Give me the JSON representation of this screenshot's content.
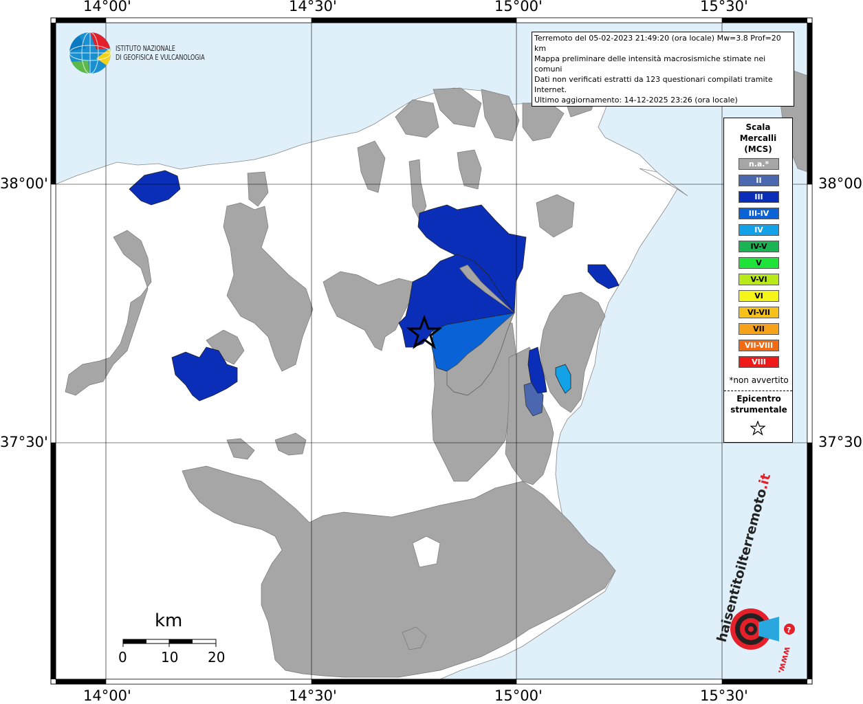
{
  "map": {
    "lon_labels": [
      "14°00'",
      "14°30'",
      "15°00'",
      "15°30'"
    ],
    "lat_labels": [
      "38°00'",
      "37°30'"
    ],
    "land_color": "#ffffff",
    "sea_color": "#e0f0fb",
    "na_color": "#a6a6a6",
    "epicenter_marker": "star"
  },
  "institute": {
    "line1": "ISTITUTO NAZIONALE",
    "line2": "DI GEOFISICA E VULCANOLOGIA",
    "logo_icon": "ingv-globe-logo"
  },
  "info": {
    "line1": "Terremoto del 05-02-2023 21:49:20 (ora locale) Mw=3.8 Prof=20 km",
    "line2": "Mappa preliminare delle intensità macrosismiche stimate nei comuni",
    "line3": "Dati non verificati estratti da 123 questionari compilati tramite Internet.",
    "line4": "Ultimo aggiornamento: 14-12-2025 23:26 (ora locale)"
  },
  "legend": {
    "title1": "Scala",
    "title2": "Mercalli",
    "title3": "(MCS)",
    "items": [
      {
        "label": "n.a.*",
        "color": "#a6a6a6",
        "text_color": "#ffffff"
      },
      {
        "label": "II",
        "color": "#4a67b0",
        "text_color": "#ffffff"
      },
      {
        "label": "III",
        "color": "#0a2eb8",
        "text_color": "#ffffff"
      },
      {
        "label": "III-IV",
        "color": "#0a63d6",
        "text_color": "#ffffff"
      },
      {
        "label": "IV",
        "color": "#13a1e8",
        "text_color": "#ffffff"
      },
      {
        "label": "IV-V",
        "color": "#1ab552",
        "text_color": "#000000"
      },
      {
        "label": "V",
        "color": "#1fe23a",
        "text_color": "#000000"
      },
      {
        "label": "V-VI",
        "color": "#b8ea1a",
        "text_color": "#000000"
      },
      {
        "label": "VI",
        "color": "#f6f51a",
        "text_color": "#000000"
      },
      {
        "label": "VI-VII",
        "color": "#f6c21a",
        "text_color": "#000000"
      },
      {
        "label": "VII",
        "color": "#f6a21a",
        "text_color": "#000000"
      },
      {
        "label": "VII-VIII",
        "color": "#f26a12",
        "text_color": "#ffffff"
      },
      {
        "label": "VIII",
        "color": "#ee1a1a",
        "text_color": "#ffffff"
      }
    ],
    "note": "*non avvertito",
    "epi1": "Epicentro",
    "epi2": "strumentale"
  },
  "scale_bar": {
    "unit": "km",
    "ticks": [
      "0",
      "10",
      "20"
    ]
  },
  "watermark": {
    "text_main": "haisentitoilterremoto",
    "text_suffix": ".it",
    "url": "www.",
    "icon": "megaphone-question-icon"
  }
}
